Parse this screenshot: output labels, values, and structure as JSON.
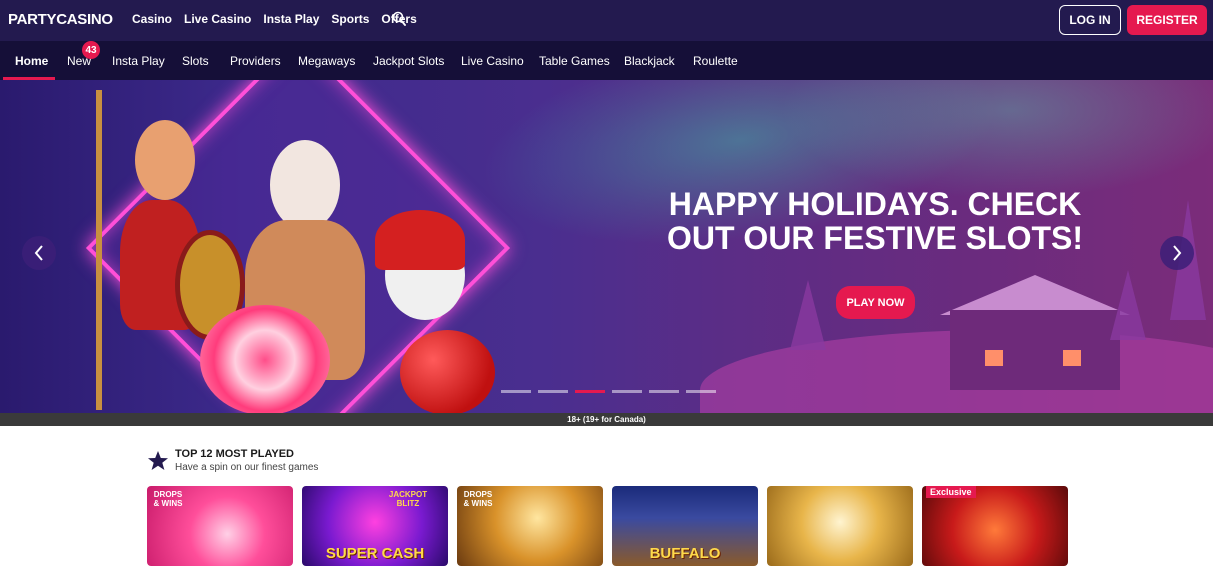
{
  "header": {
    "logo": "PARTYCASINO",
    "nav": [
      "Casino",
      "Live Casino",
      "Insta Play",
      "Sports",
      "Offers"
    ],
    "login_label": "LOG IN",
    "register_label": "REGISTER"
  },
  "subnav": {
    "items": [
      "Home",
      "New",
      "Insta Play",
      "Slots",
      "Providers",
      "Megaways",
      "Jackpot Slots",
      "Live Casino",
      "Table Games",
      "Blackjack",
      "Roulette"
    ],
    "active": "Home",
    "new_badge_count": "43"
  },
  "hero": {
    "headline_line1": "HAPPY HOLIDAYS. CHECK",
    "headline_line2": "OUT OUR FESTIVE SLOTS!",
    "cta_label": "PLAY NOW",
    "slide_count": 6,
    "active_slide": 3,
    "age_notice": "18+ (19+ for Canada)"
  },
  "most_played": {
    "title": "TOP 12 MOST PLAYED",
    "subtitle": "Have a spin on our finest games",
    "tiles": [
      {
        "badge": "",
        "corner_text": "DROPS & WINS",
        "label": "",
        "bg": "#e23a8a"
      },
      {
        "badge": "",
        "corner_text": "JACKPOT BLITZ",
        "label": "SUPER CASH",
        "bg": "#5a1aa8"
      },
      {
        "badge": "",
        "corner_text": "DROPS & WINS",
        "label": "",
        "bg": "#c98a2a"
      },
      {
        "badge": "",
        "corner_text": "",
        "label": "BUFFALO",
        "bg": "#2a3f8a"
      },
      {
        "badge": "",
        "corner_text": "",
        "label": "",
        "bg": "#e8b54a"
      },
      {
        "badge": "Exclusive",
        "corner_text": "",
        "label": "",
        "bg": "#b51a1a"
      }
    ]
  },
  "colors": {
    "header_bg": "#231a4f",
    "subnav_bg": "#150f38",
    "accent": "#e5194f"
  }
}
